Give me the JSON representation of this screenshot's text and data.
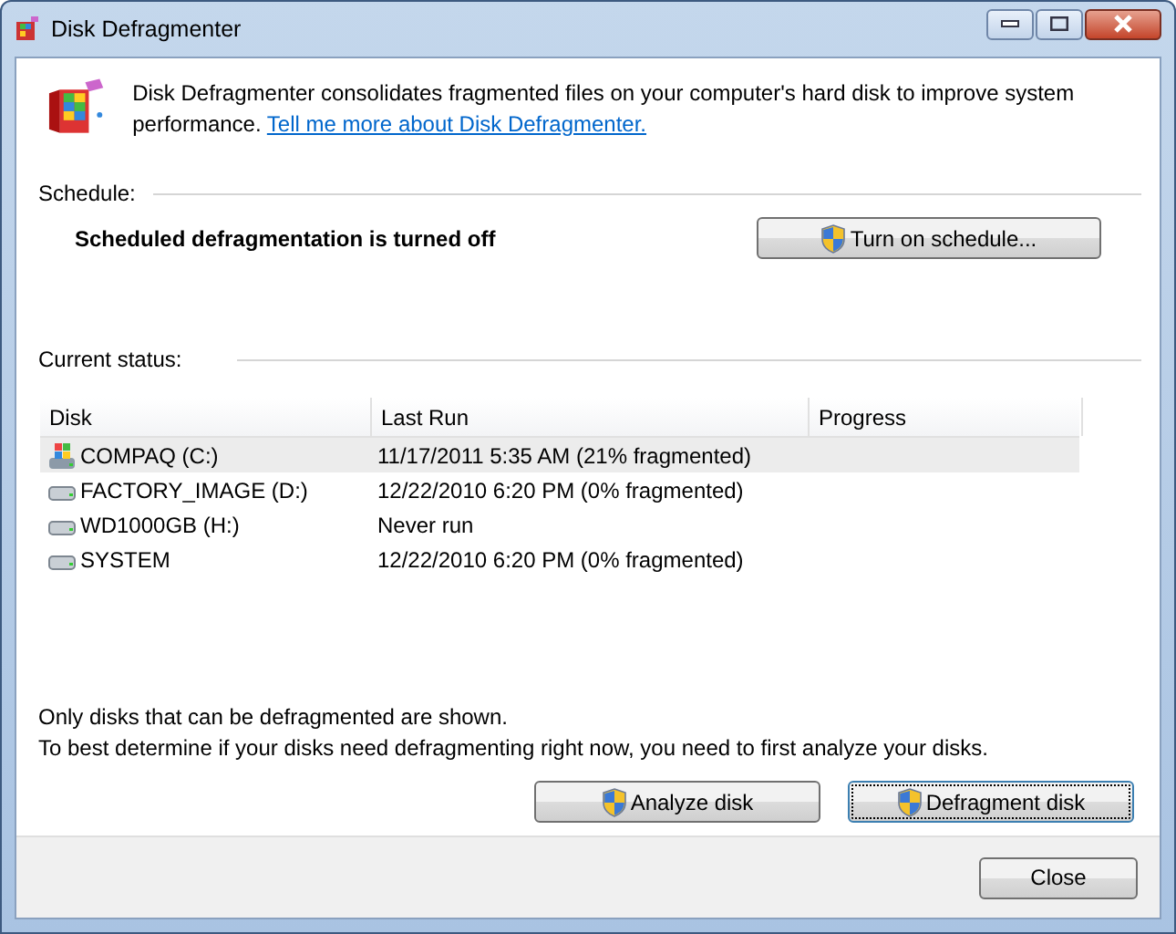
{
  "window": {
    "title": "Disk Defragmenter"
  },
  "intro": {
    "text": "Disk Defragmenter consolidates fragmented files on your computer's hard disk to improve system performance.",
    "link": "Tell me more about Disk Defragmenter."
  },
  "schedule": {
    "label": "Schedule:",
    "status": "Scheduled defragmentation is turned off",
    "button": "Turn on schedule..."
  },
  "current_status": {
    "label": "Current status:"
  },
  "table": {
    "columns": [
      "Disk",
      "Last Run",
      "Progress"
    ],
    "rows": [
      {
        "kind": "system",
        "disk": "COMPAQ (C:)",
        "last_run": "11/17/2011 5:35 AM (21% fragmented)",
        "selected": true
      },
      {
        "kind": "drive",
        "disk": "FACTORY_IMAGE (D:)",
        "last_run": "12/22/2010 6:20 PM (0% fragmented)",
        "selected": false
      },
      {
        "kind": "drive",
        "disk": "WD1000GB (H:)",
        "last_run": "Never run",
        "selected": false
      },
      {
        "kind": "drive",
        "disk": "SYSTEM",
        "last_run": "12/22/2010 6:20 PM (0% fragmented)",
        "selected": false
      }
    ]
  },
  "notes": [
    "Only disks that can be defragmented are shown.",
    "To best determine if your disks need defragmenting right now, you need to first analyze your disks."
  ],
  "buttons": [
    {
      "label": "Analyze disk",
      "focused": false
    },
    {
      "label": "Defragment disk",
      "focused": true
    }
  ],
  "footer": {
    "close": "Close"
  }
}
